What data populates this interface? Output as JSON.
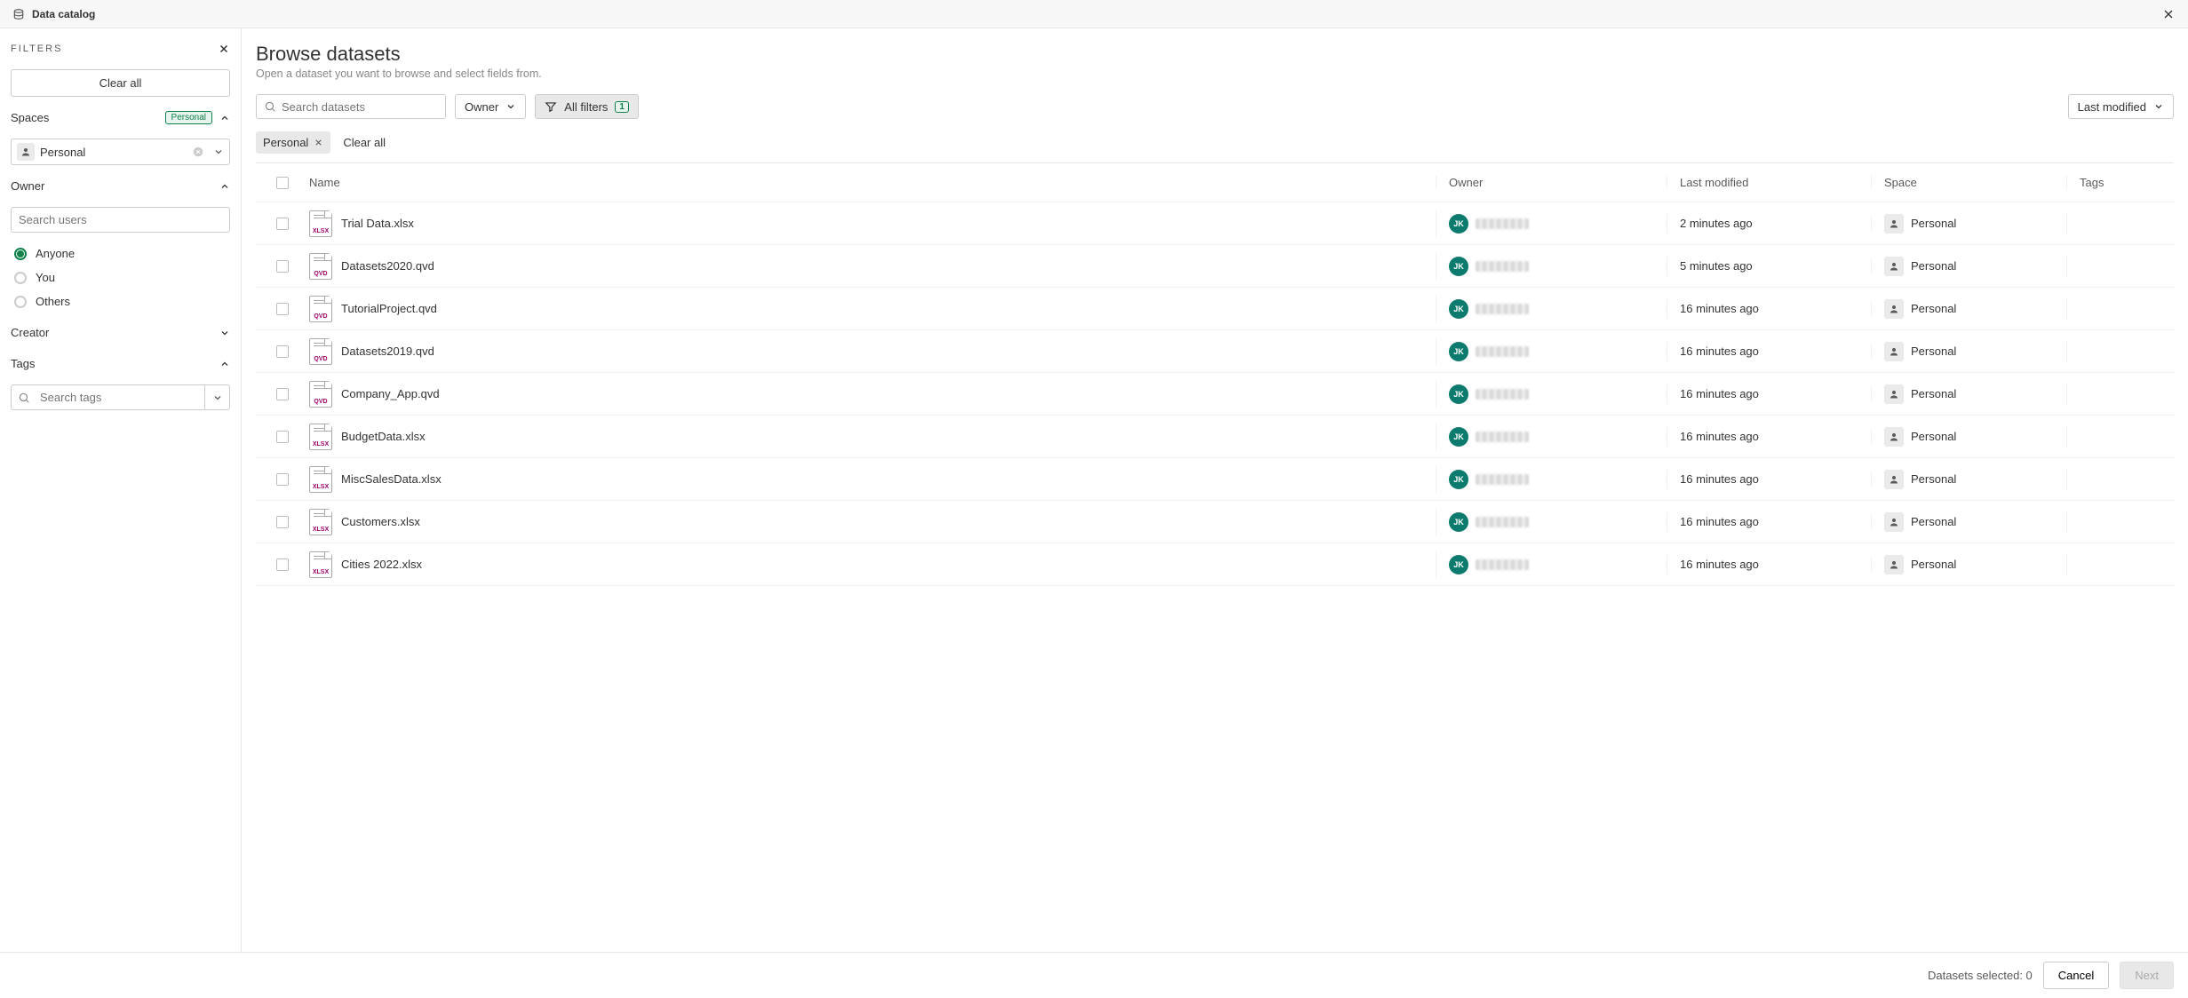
{
  "header": {
    "title": "Data catalog"
  },
  "filters": {
    "label": "FILTERS",
    "clear_all": "Clear all",
    "spaces": {
      "title": "Spaces",
      "badge": "Personal",
      "selected": "Personal"
    },
    "owner": {
      "title": "Owner",
      "search_placeholder": "Search users",
      "options": {
        "anyone": "Anyone",
        "you": "You",
        "others": "Others"
      },
      "selected": "anyone"
    },
    "creator": {
      "title": "Creator"
    },
    "tags": {
      "title": "Tags",
      "search_placeholder": "Search tags"
    }
  },
  "main": {
    "title": "Browse datasets",
    "subtitle": "Open a dataset you want to browse and select fields from.",
    "search_placeholder": "Search datasets",
    "owner_dd": "Owner",
    "all_filters": "All filters",
    "all_filters_count": "1",
    "sort": "Last modified",
    "chip": "Personal",
    "clear_all": "Clear all",
    "columns": {
      "name": "Name",
      "owner": "Owner",
      "modified": "Last modified",
      "space": "Space",
      "tags": "Tags"
    },
    "rows": [
      {
        "name": "Trial Data.xlsx",
        "ext": "XLSX",
        "owner_initials": "JK",
        "modified": "2 minutes ago",
        "space": "Personal"
      },
      {
        "name": "Datasets2020.qvd",
        "ext": "QVD",
        "owner_initials": "JK",
        "modified": "5 minutes ago",
        "space": "Personal"
      },
      {
        "name": "TutorialProject.qvd",
        "ext": "QVD",
        "owner_initials": "JK",
        "modified": "16 minutes ago",
        "space": "Personal"
      },
      {
        "name": "Datasets2019.qvd",
        "ext": "QVD",
        "owner_initials": "JK",
        "modified": "16 minutes ago",
        "space": "Personal"
      },
      {
        "name": "Company_App.qvd",
        "ext": "QVD",
        "owner_initials": "JK",
        "modified": "16 minutes ago",
        "space": "Personal"
      },
      {
        "name": "BudgetData.xlsx",
        "ext": "XLSX",
        "owner_initials": "JK",
        "modified": "16 minutes ago",
        "space": "Personal"
      },
      {
        "name": "MiscSalesData.xlsx",
        "ext": "XLSX",
        "owner_initials": "JK",
        "modified": "16 minutes ago",
        "space": "Personal"
      },
      {
        "name": "Customers.xlsx",
        "ext": "XLSX",
        "owner_initials": "JK",
        "modified": "16 minutes ago",
        "space": "Personal"
      },
      {
        "name": "Cities 2022.xlsx",
        "ext": "XLSX",
        "owner_initials": "JK",
        "modified": "16 minutes ago",
        "space": "Personal"
      }
    ]
  },
  "footer": {
    "status": "Datasets selected: 0",
    "cancel": "Cancel",
    "next": "Next"
  }
}
